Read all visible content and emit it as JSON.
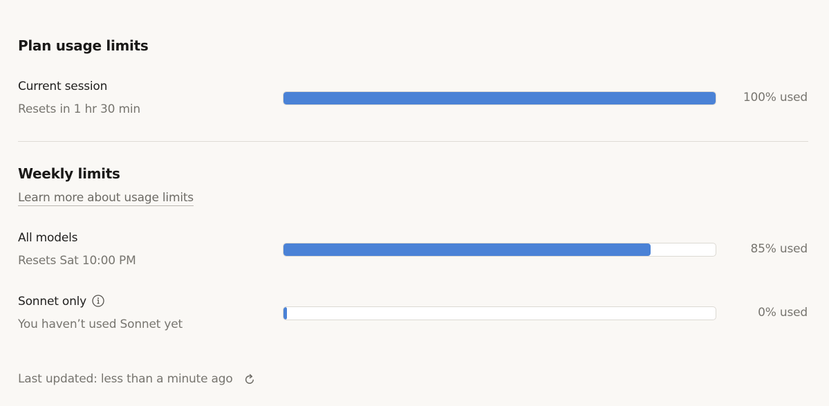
{
  "plan": {
    "title": "Plan usage limits",
    "session": {
      "label": "Current session",
      "reset": "Resets in 1 hr 30 min",
      "percent_text": "100% used",
      "fraction": 1.0
    }
  },
  "weekly": {
    "title": "Weekly limits",
    "learn_more": "Learn more about usage limits",
    "all_models": {
      "label": "All models",
      "reset": "Resets Sat 10:00 PM",
      "percent_text": "85% used",
      "fraction": 0.85
    },
    "sonnet": {
      "label": "Sonnet only",
      "info_icon": "info-icon",
      "reset": "You haven’t used Sonnet yet",
      "percent_text": "0% used",
      "fraction": 0.0
    }
  },
  "footer": {
    "last_updated": "Last updated: less than a minute ago",
    "refresh_icon": "refresh-icon"
  },
  "colors": {
    "bar_fill": "#4a82d6",
    "background": "#faf8f5"
  }
}
